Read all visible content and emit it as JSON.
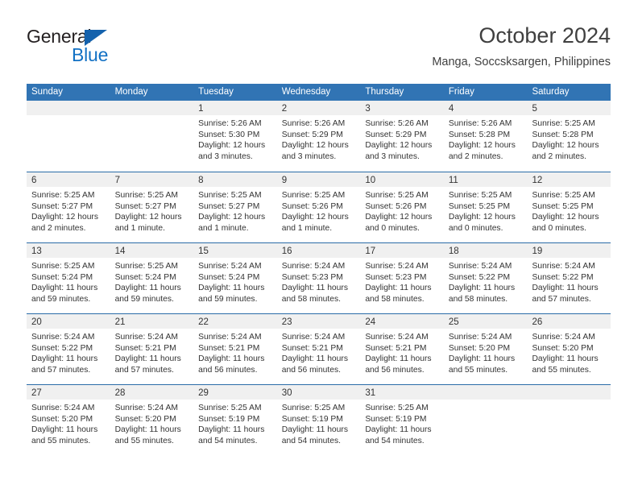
{
  "brand": {
    "name_top": "General",
    "name_bottom": "Blue",
    "accent_color": "#1271c4",
    "triangle_color": "#1462ad"
  },
  "header": {
    "title": "October 2024",
    "subtitle": "Manga, Soccsksargen, Philippines"
  },
  "theme": {
    "header_row_bg": "#3174b4",
    "week_separator": "#2b6ca8",
    "day_band_bg": "#f0f0f0",
    "text_color": "#333333"
  },
  "weekdays": [
    "Sunday",
    "Monday",
    "Tuesday",
    "Wednesday",
    "Thursday",
    "Friday",
    "Saturday"
  ],
  "labels": {
    "sunrise_prefix": "Sunrise:",
    "sunset_prefix": "Sunset:",
    "daylight_prefix": "Daylight:"
  },
  "weeks": [
    [
      {
        "day": "",
        "lines": []
      },
      {
        "day": "",
        "lines": []
      },
      {
        "day": "1",
        "lines": [
          "Sunrise: 5:26 AM",
          "Sunset: 5:30 PM",
          "Daylight: 12 hours and 3 minutes."
        ]
      },
      {
        "day": "2",
        "lines": [
          "Sunrise: 5:26 AM",
          "Sunset: 5:29 PM",
          "Daylight: 12 hours and 3 minutes."
        ]
      },
      {
        "day": "3",
        "lines": [
          "Sunrise: 5:26 AM",
          "Sunset: 5:29 PM",
          "Daylight: 12 hours and 3 minutes."
        ]
      },
      {
        "day": "4",
        "lines": [
          "Sunrise: 5:26 AM",
          "Sunset: 5:28 PM",
          "Daylight: 12 hours and 2 minutes."
        ]
      },
      {
        "day": "5",
        "lines": [
          "Sunrise: 5:25 AM",
          "Sunset: 5:28 PM",
          "Daylight: 12 hours and 2 minutes."
        ]
      }
    ],
    [
      {
        "day": "6",
        "lines": [
          "Sunrise: 5:25 AM",
          "Sunset: 5:27 PM",
          "Daylight: 12 hours and 2 minutes."
        ]
      },
      {
        "day": "7",
        "lines": [
          "Sunrise: 5:25 AM",
          "Sunset: 5:27 PM",
          "Daylight: 12 hours and 1 minute."
        ]
      },
      {
        "day": "8",
        "lines": [
          "Sunrise: 5:25 AM",
          "Sunset: 5:27 PM",
          "Daylight: 12 hours and 1 minute."
        ]
      },
      {
        "day": "9",
        "lines": [
          "Sunrise: 5:25 AM",
          "Sunset: 5:26 PM",
          "Daylight: 12 hours and 1 minute."
        ]
      },
      {
        "day": "10",
        "lines": [
          "Sunrise: 5:25 AM",
          "Sunset: 5:26 PM",
          "Daylight: 12 hours and 0 minutes."
        ]
      },
      {
        "day": "11",
        "lines": [
          "Sunrise: 5:25 AM",
          "Sunset: 5:25 PM",
          "Daylight: 12 hours and 0 minutes."
        ]
      },
      {
        "day": "12",
        "lines": [
          "Sunrise: 5:25 AM",
          "Sunset: 5:25 PM",
          "Daylight: 12 hours and 0 minutes."
        ]
      }
    ],
    [
      {
        "day": "13",
        "lines": [
          "Sunrise: 5:25 AM",
          "Sunset: 5:24 PM",
          "Daylight: 11 hours and 59 minutes."
        ]
      },
      {
        "day": "14",
        "lines": [
          "Sunrise: 5:25 AM",
          "Sunset: 5:24 PM",
          "Daylight: 11 hours and 59 minutes."
        ]
      },
      {
        "day": "15",
        "lines": [
          "Sunrise: 5:24 AM",
          "Sunset: 5:24 PM",
          "Daylight: 11 hours and 59 minutes."
        ]
      },
      {
        "day": "16",
        "lines": [
          "Sunrise: 5:24 AM",
          "Sunset: 5:23 PM",
          "Daylight: 11 hours and 58 minutes."
        ]
      },
      {
        "day": "17",
        "lines": [
          "Sunrise: 5:24 AM",
          "Sunset: 5:23 PM",
          "Daylight: 11 hours and 58 minutes."
        ]
      },
      {
        "day": "18",
        "lines": [
          "Sunrise: 5:24 AM",
          "Sunset: 5:22 PM",
          "Daylight: 11 hours and 58 minutes."
        ]
      },
      {
        "day": "19",
        "lines": [
          "Sunrise: 5:24 AM",
          "Sunset: 5:22 PM",
          "Daylight: 11 hours and 57 minutes."
        ]
      }
    ],
    [
      {
        "day": "20",
        "lines": [
          "Sunrise: 5:24 AM",
          "Sunset: 5:22 PM",
          "Daylight: 11 hours and 57 minutes."
        ]
      },
      {
        "day": "21",
        "lines": [
          "Sunrise: 5:24 AM",
          "Sunset: 5:21 PM",
          "Daylight: 11 hours and 57 minutes."
        ]
      },
      {
        "day": "22",
        "lines": [
          "Sunrise: 5:24 AM",
          "Sunset: 5:21 PM",
          "Daylight: 11 hours and 56 minutes."
        ]
      },
      {
        "day": "23",
        "lines": [
          "Sunrise: 5:24 AM",
          "Sunset: 5:21 PM",
          "Daylight: 11 hours and 56 minutes."
        ]
      },
      {
        "day": "24",
        "lines": [
          "Sunrise: 5:24 AM",
          "Sunset: 5:21 PM",
          "Daylight: 11 hours and 56 minutes."
        ]
      },
      {
        "day": "25",
        "lines": [
          "Sunrise: 5:24 AM",
          "Sunset: 5:20 PM",
          "Daylight: 11 hours and 55 minutes."
        ]
      },
      {
        "day": "26",
        "lines": [
          "Sunrise: 5:24 AM",
          "Sunset: 5:20 PM",
          "Daylight: 11 hours and 55 minutes."
        ]
      }
    ],
    [
      {
        "day": "27",
        "lines": [
          "Sunrise: 5:24 AM",
          "Sunset: 5:20 PM",
          "Daylight: 11 hours and 55 minutes."
        ]
      },
      {
        "day": "28",
        "lines": [
          "Sunrise: 5:24 AM",
          "Sunset: 5:20 PM",
          "Daylight: 11 hours and 55 minutes."
        ]
      },
      {
        "day": "29",
        "lines": [
          "Sunrise: 5:25 AM",
          "Sunset: 5:19 PM",
          "Daylight: 11 hours and 54 minutes."
        ]
      },
      {
        "day": "30",
        "lines": [
          "Sunrise: 5:25 AM",
          "Sunset: 5:19 PM",
          "Daylight: 11 hours and 54 minutes."
        ]
      },
      {
        "day": "31",
        "lines": [
          "Sunrise: 5:25 AM",
          "Sunset: 5:19 PM",
          "Daylight: 11 hours and 54 minutes."
        ]
      },
      {
        "day": "",
        "lines": []
      },
      {
        "day": "",
        "lines": []
      }
    ]
  ]
}
